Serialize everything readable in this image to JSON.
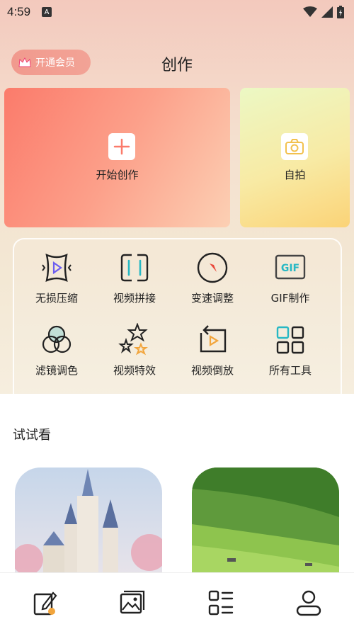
{
  "status_bar": {
    "time": "4:59",
    "notif_badge": "A"
  },
  "header": {
    "vip_label": "开通会员",
    "title": "创作"
  },
  "cards": {
    "create_label": "开始创作",
    "selfie_label": "自拍"
  },
  "tools": [
    {
      "label": "无损压缩",
      "icon": "compress-icon"
    },
    {
      "label": "视频拼接",
      "icon": "splice-icon"
    },
    {
      "label": "变速调整",
      "icon": "speed-icon"
    },
    {
      "label": "GIF制作",
      "icon": "gif-icon"
    },
    {
      "label": "滤镜调色",
      "icon": "filter-icon"
    },
    {
      "label": "视频特效",
      "icon": "effects-icon"
    },
    {
      "label": "视频倒放",
      "icon": "reverse-icon"
    },
    {
      "label": "所有工具",
      "icon": "all-tools-icon"
    }
  ],
  "try_section": {
    "title": "试试看"
  },
  "tabbar": [
    "create-tab-icon",
    "gallery-tab-icon",
    "list-tab-icon",
    "profile-tab-icon"
  ],
  "colors": {
    "accent": "#f19a8e",
    "panel_border": "#ffffff"
  }
}
